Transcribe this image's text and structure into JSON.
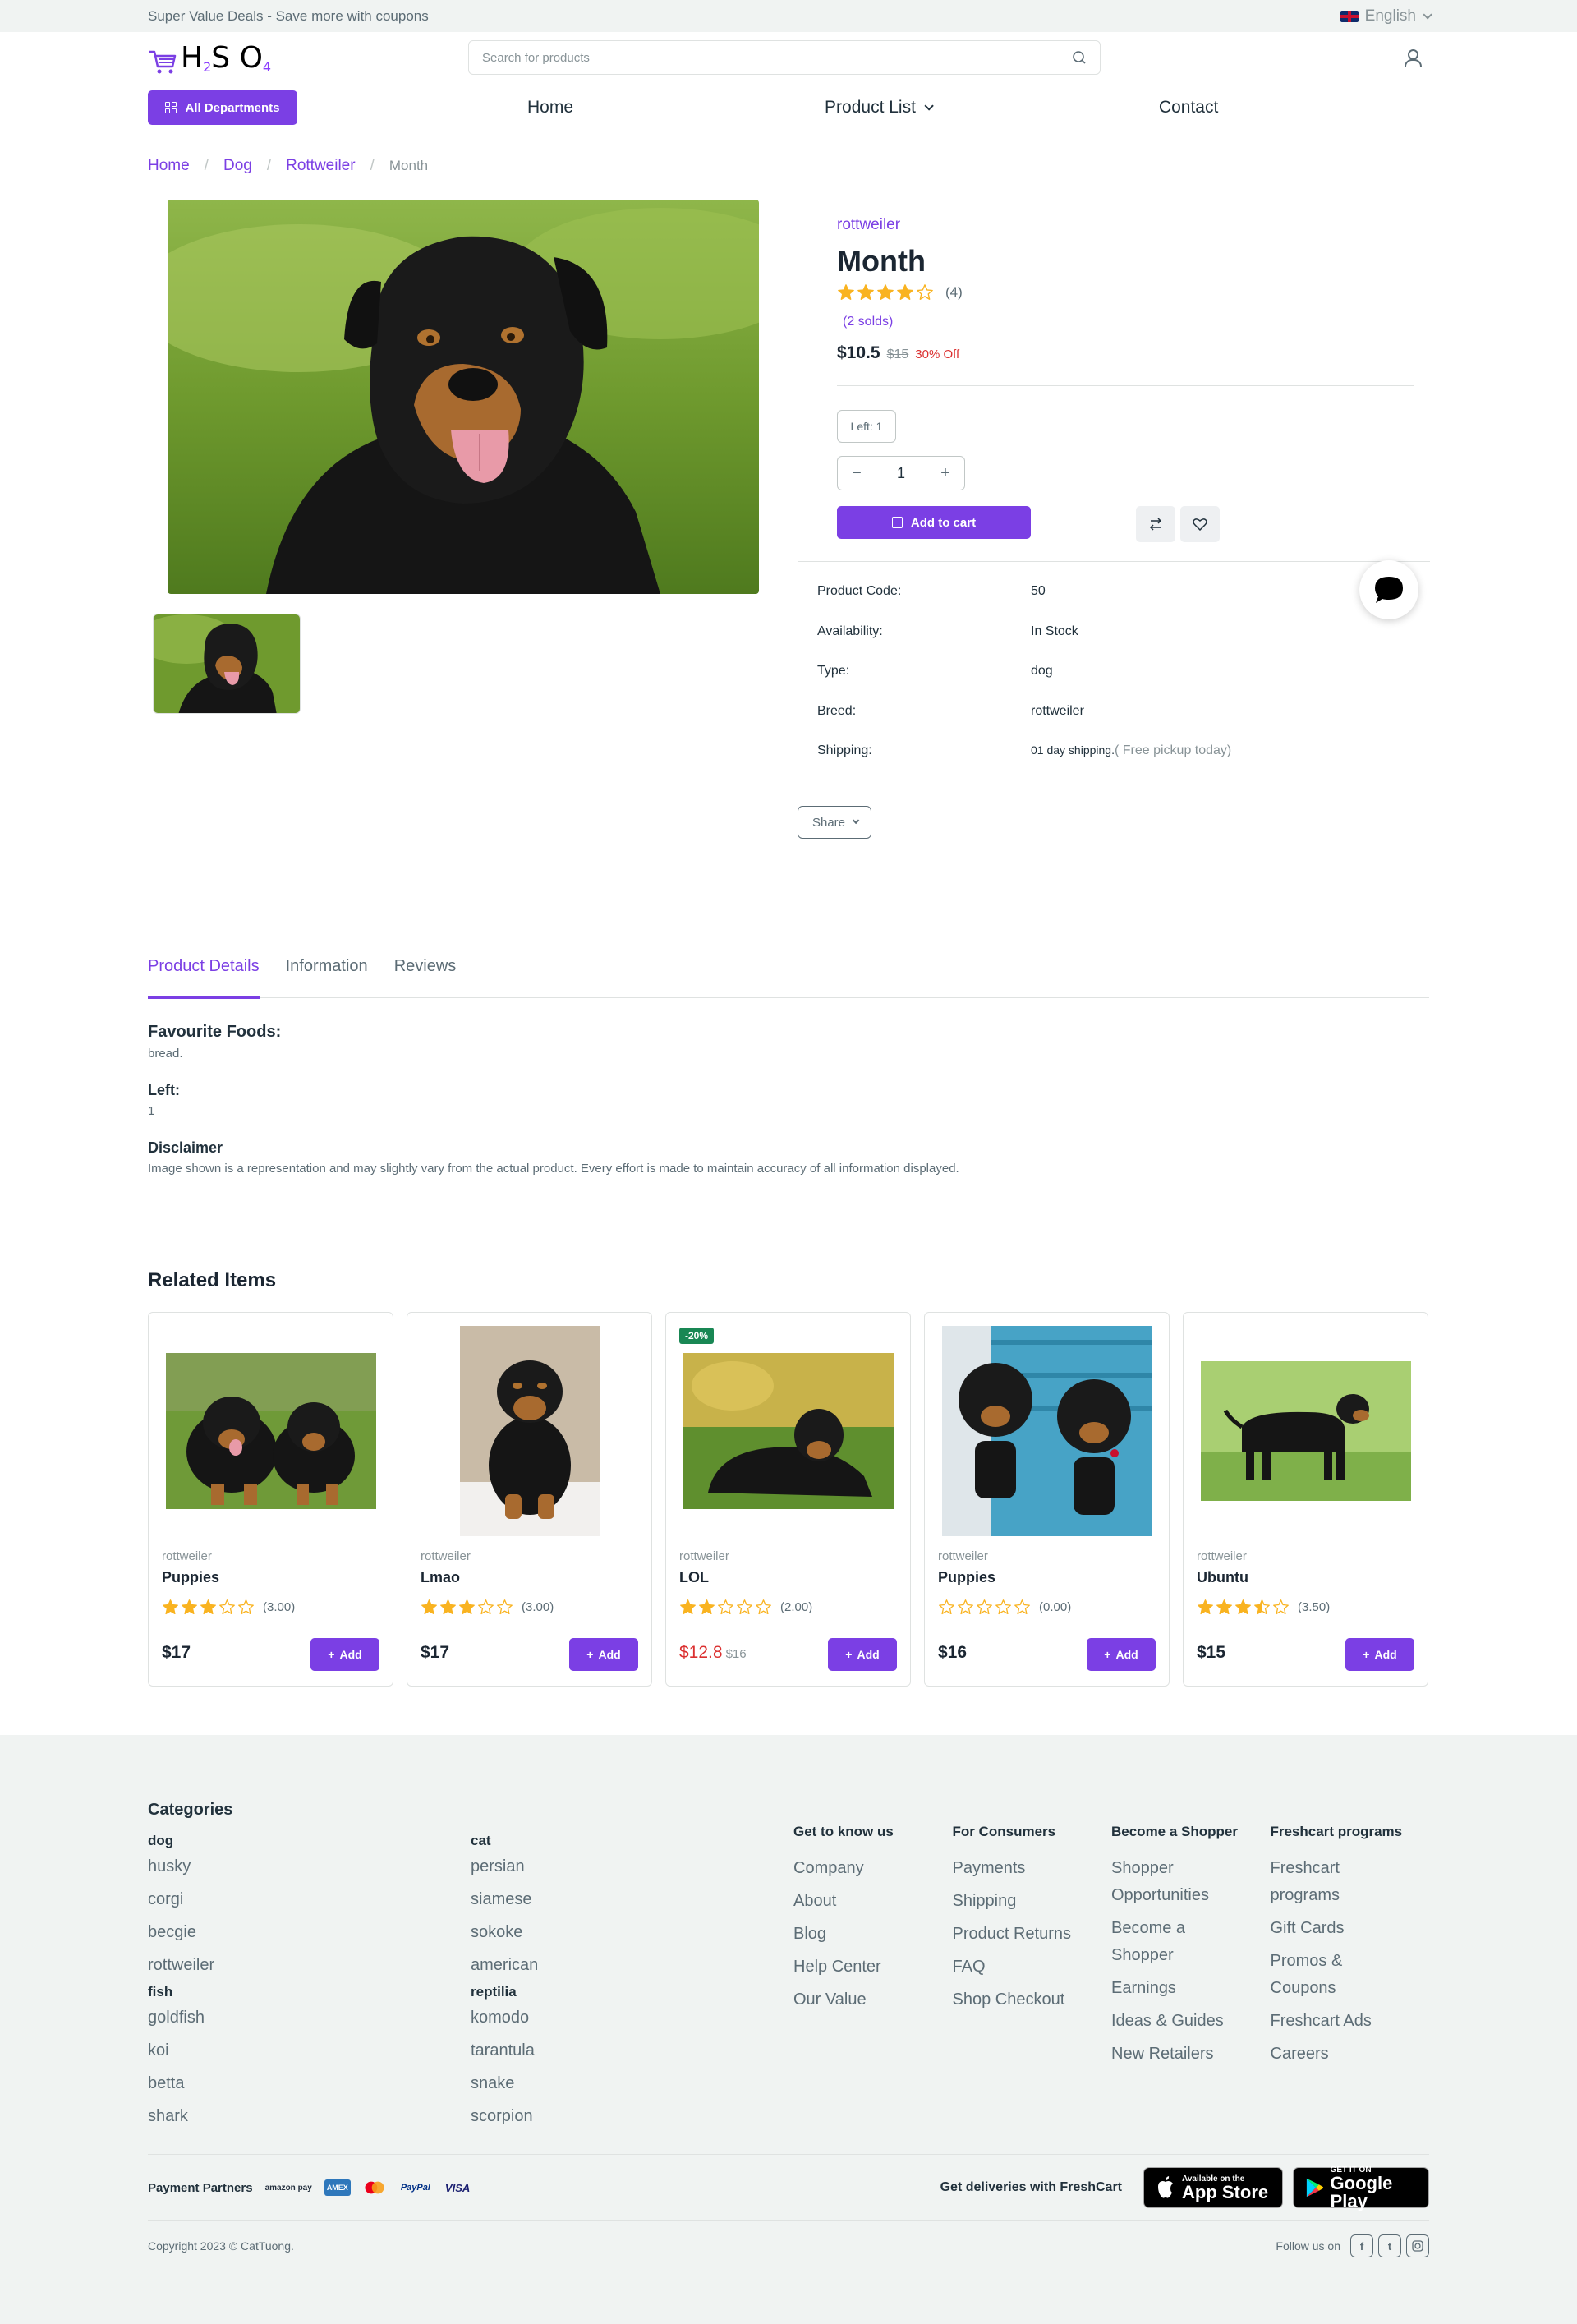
{
  "topbar": {
    "promo": "Super Value Deals - Save more with coupons",
    "language": "English"
  },
  "header": {
    "logo": {
      "h": "H",
      "two": "2",
      "s": "S",
      "o": "O",
      "four": "4"
    },
    "search_placeholder": "Search for products",
    "departments_label": "All Departments",
    "nav": [
      {
        "label": "Home"
      },
      {
        "label": "Product List"
      },
      {
        "label": "Contact"
      }
    ]
  },
  "breadcrumb": [
    {
      "label": "Home"
    },
    {
      "label": "Dog"
    },
    {
      "label": "Rottweiler"
    },
    {
      "label": "Month"
    }
  ],
  "product": {
    "brand": "rottweiler",
    "title": "Month",
    "rating": 4,
    "rating_count": "(4)",
    "solds": "(2 solds)",
    "price": "$10.5",
    "old_price": "$15",
    "discount": "30% Off",
    "left_badge": "Left: 1",
    "quantity": "1",
    "add_to_cart": "Add to cart",
    "share": "Share",
    "specs": [
      {
        "k": "Product Code:",
        "v": "50"
      },
      {
        "k": "Availability:",
        "v": "In Stock"
      },
      {
        "k": "Type:",
        "v": "dog"
      },
      {
        "k": "Breed:",
        "v": "rottweiler"
      }
    ],
    "shipping_label": "Shipping:",
    "shipping_value": "01 day shipping.",
    "shipping_note": "( Free pickup today)"
  },
  "tabs": [
    {
      "label": "Product Details"
    },
    {
      "label": "Information"
    },
    {
      "label": "Reviews"
    }
  ],
  "details": {
    "foods_title": "Favourite Foods:",
    "foods_value": "bread.",
    "left_title": "Left:",
    "left_value": "1",
    "disclaimer_title": "Disclaimer",
    "disclaimer_text": "Image shown is a representation and may slightly vary from the actual product. Every effort is made to maintain accuracy of all information displayed."
  },
  "related": {
    "title": "Related Items",
    "add_label": "Add",
    "items": [
      {
        "cat": "rottweiler",
        "name": "Puppies",
        "rating": 3,
        "rating_text": "(3.00)",
        "price": "$17"
      },
      {
        "cat": "rottweiler",
        "name": "Lmao",
        "rating": 3,
        "rating_text": "(3.00)",
        "price": "$17"
      },
      {
        "cat": "rottweiler",
        "name": "LOL",
        "rating": 2,
        "rating_text": "(2.00)",
        "price": "$12.8",
        "old_price": "$16",
        "tag": "-20%"
      },
      {
        "cat": "rottweiler",
        "name": "Puppies",
        "rating": 0,
        "rating_text": "(0.00)",
        "price": "$16"
      },
      {
        "cat": "rottweiler",
        "name": "Ubuntu",
        "rating": 3.5,
        "rating_text": "(3.50)",
        "price": "$15"
      }
    ]
  },
  "footer": {
    "categories_title": "Categories",
    "groups": [
      {
        "name": "dog",
        "items": [
          "husky",
          "corgi",
          "becgie",
          "rottweiler"
        ]
      },
      {
        "name": "cat",
        "items": [
          "persian",
          "siamese",
          "sokoke",
          "american"
        ]
      },
      {
        "name": "fish",
        "items": [
          "goldfish",
          "koi",
          "betta",
          "shark"
        ]
      },
      {
        "name": "reptilia",
        "items": [
          "komodo",
          "tarantula",
          "snake",
          "scorpion"
        ]
      }
    ],
    "link_cols": [
      {
        "title": "Get to know us",
        "links": [
          "Company",
          "About",
          "Blog",
          "Help Center",
          "Our Value"
        ]
      },
      {
        "title": "For Consumers",
        "links": [
          "Payments",
          "Shipping",
          "Product Returns",
          "FAQ",
          "Shop Checkout"
        ]
      },
      {
        "title": "Become a Shopper",
        "links": [
          "Shopper Opportunities",
          "Become a Shopper",
          "Earnings",
          "Ideas & Guides",
          "New Retailers"
        ]
      },
      {
        "title": "Freshcart programs",
        "links": [
          "Freshcart programs",
          "Gift Cards",
          "Promos & Coupons",
          "Freshcart Ads",
          "Careers"
        ]
      }
    ],
    "payment_label": "Payment Partners",
    "payment_logos": [
      "amazon pay",
      "AMEX",
      "mastercard",
      "PayPal",
      "VISA"
    ],
    "deliveries_label": "Get deliveries with FreshCart",
    "app_store": {
      "small": "Available on the",
      "big": "App Store"
    },
    "google_play": {
      "small": "GET IT ON",
      "big": "Google Play"
    },
    "copyright": "Copyright 2023 © CatTuong.",
    "follow_label": "Follow us on"
  },
  "colors": {
    "accent": "#7b3fe4",
    "star": "#f9b320",
    "sale": "#db3030",
    "badge": "#198754"
  }
}
